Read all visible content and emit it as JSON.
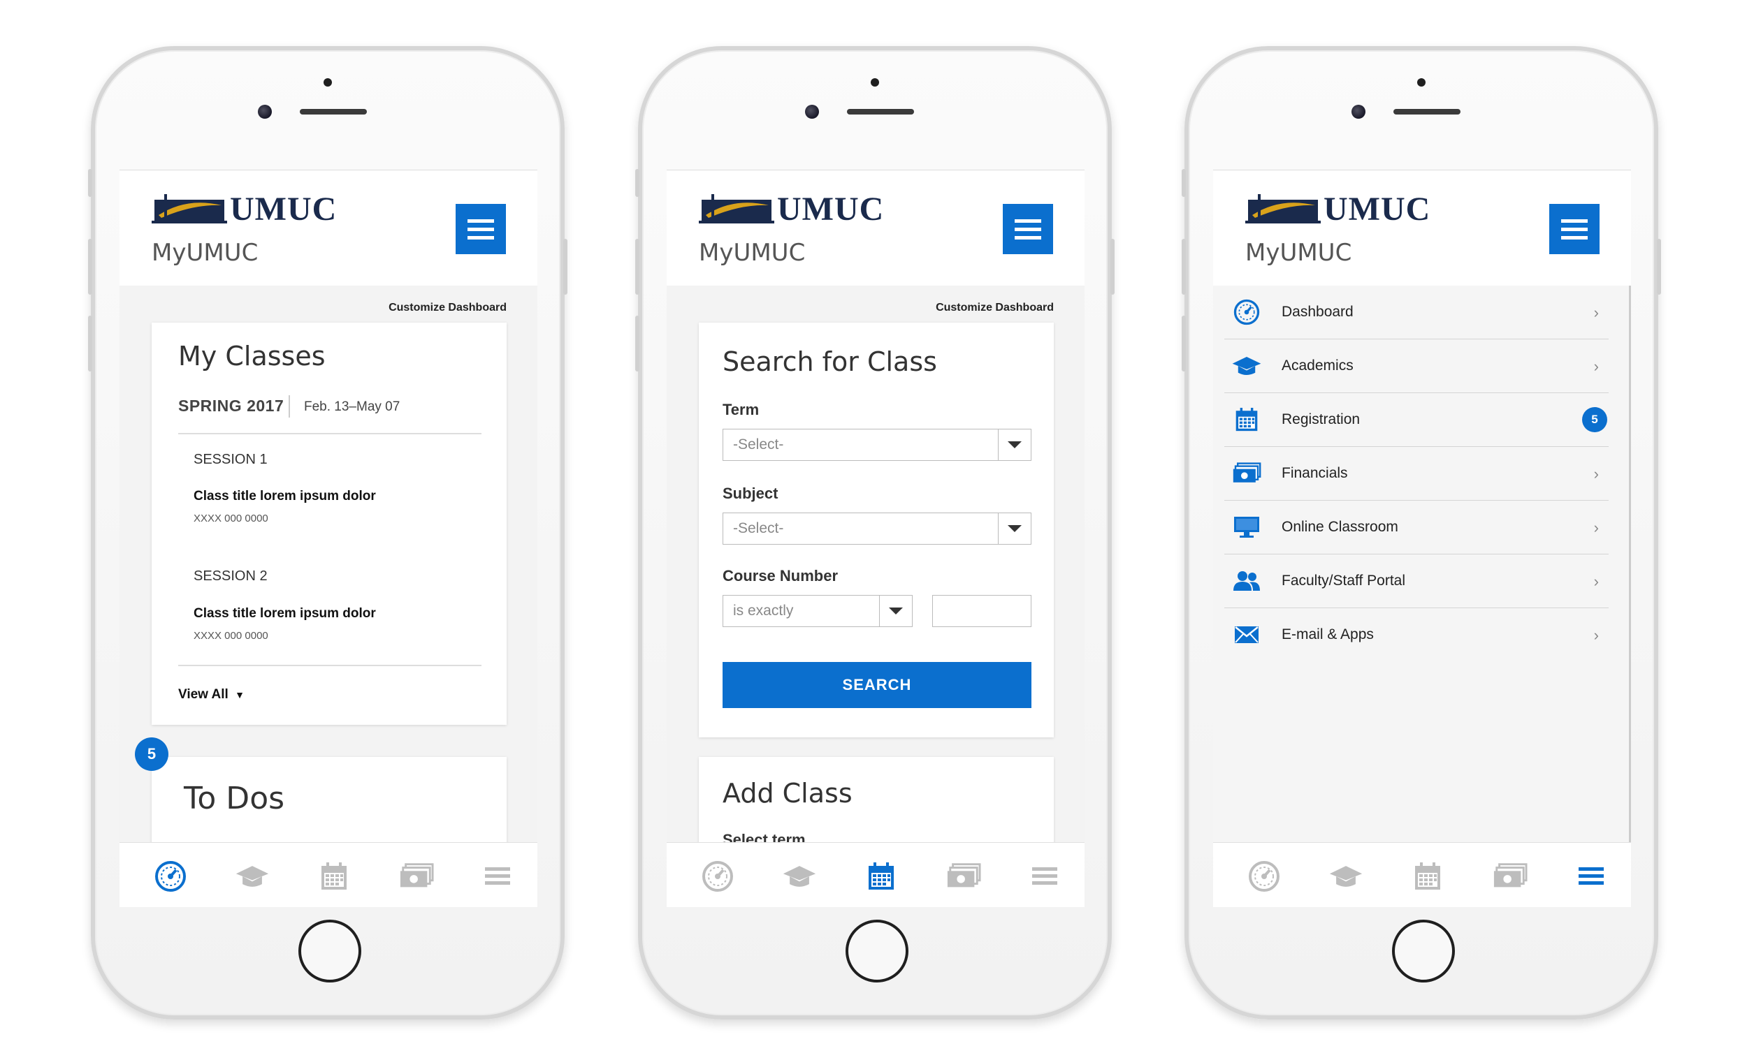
{
  "colors": {
    "accent": "#0b6fce",
    "navy": "#1a2a4c",
    "gold": "#d9a21b",
    "inactive_icon": "#bdbdbd"
  },
  "app": {
    "logo_text": "UMUC",
    "name": "MyUMUC",
    "customize_label": "Customize Dashboard"
  },
  "phone1": {
    "my_classes": {
      "title": "My Classes",
      "term": "SPRING 2017",
      "term_dates": "Feb. 13–May 07",
      "sessions": [
        {
          "label": "SESSION 1",
          "class_title": "Class title lorem ipsum dolor",
          "class_code": "XXXX 000 0000"
        },
        {
          "label": "SESSION 2",
          "class_title": "Class title lorem ipsum dolor",
          "class_code": "XXXX 000 0000"
        }
      ],
      "view_all": "View All"
    },
    "todos": {
      "title": "To Dos",
      "badge": "5"
    },
    "active_tab": "dashboard"
  },
  "phone2": {
    "search": {
      "title": "Search for Class",
      "term_label": "Term",
      "term_value": "-Select-",
      "subject_label": "Subject",
      "subject_value": "-Select-",
      "course_label": "Course Number",
      "course_operator": "is exactly",
      "course_value": "",
      "button": "SEARCH"
    },
    "add_class": {
      "title": "Add Class",
      "partial_label": "Select term"
    },
    "active_tab": "registration"
  },
  "phone3": {
    "nav_items": [
      {
        "label": "Dashboard",
        "icon": "dashboard-icon"
      },
      {
        "label": "Academics",
        "icon": "graduation-cap-icon"
      },
      {
        "label": "Registration",
        "icon": "calendar-icon",
        "badge": "5"
      },
      {
        "label": "Financials",
        "icon": "money-icon"
      },
      {
        "label": "Online Classroom",
        "icon": "monitor-icon"
      },
      {
        "label": "Faculty/Staff Portal",
        "icon": "people-icon"
      },
      {
        "label": "E-mail & Apps",
        "icon": "envelope-icon"
      }
    ],
    "active_tab": "menu"
  },
  "tabs": [
    "dashboard",
    "academics",
    "registration",
    "financials",
    "menu"
  ]
}
